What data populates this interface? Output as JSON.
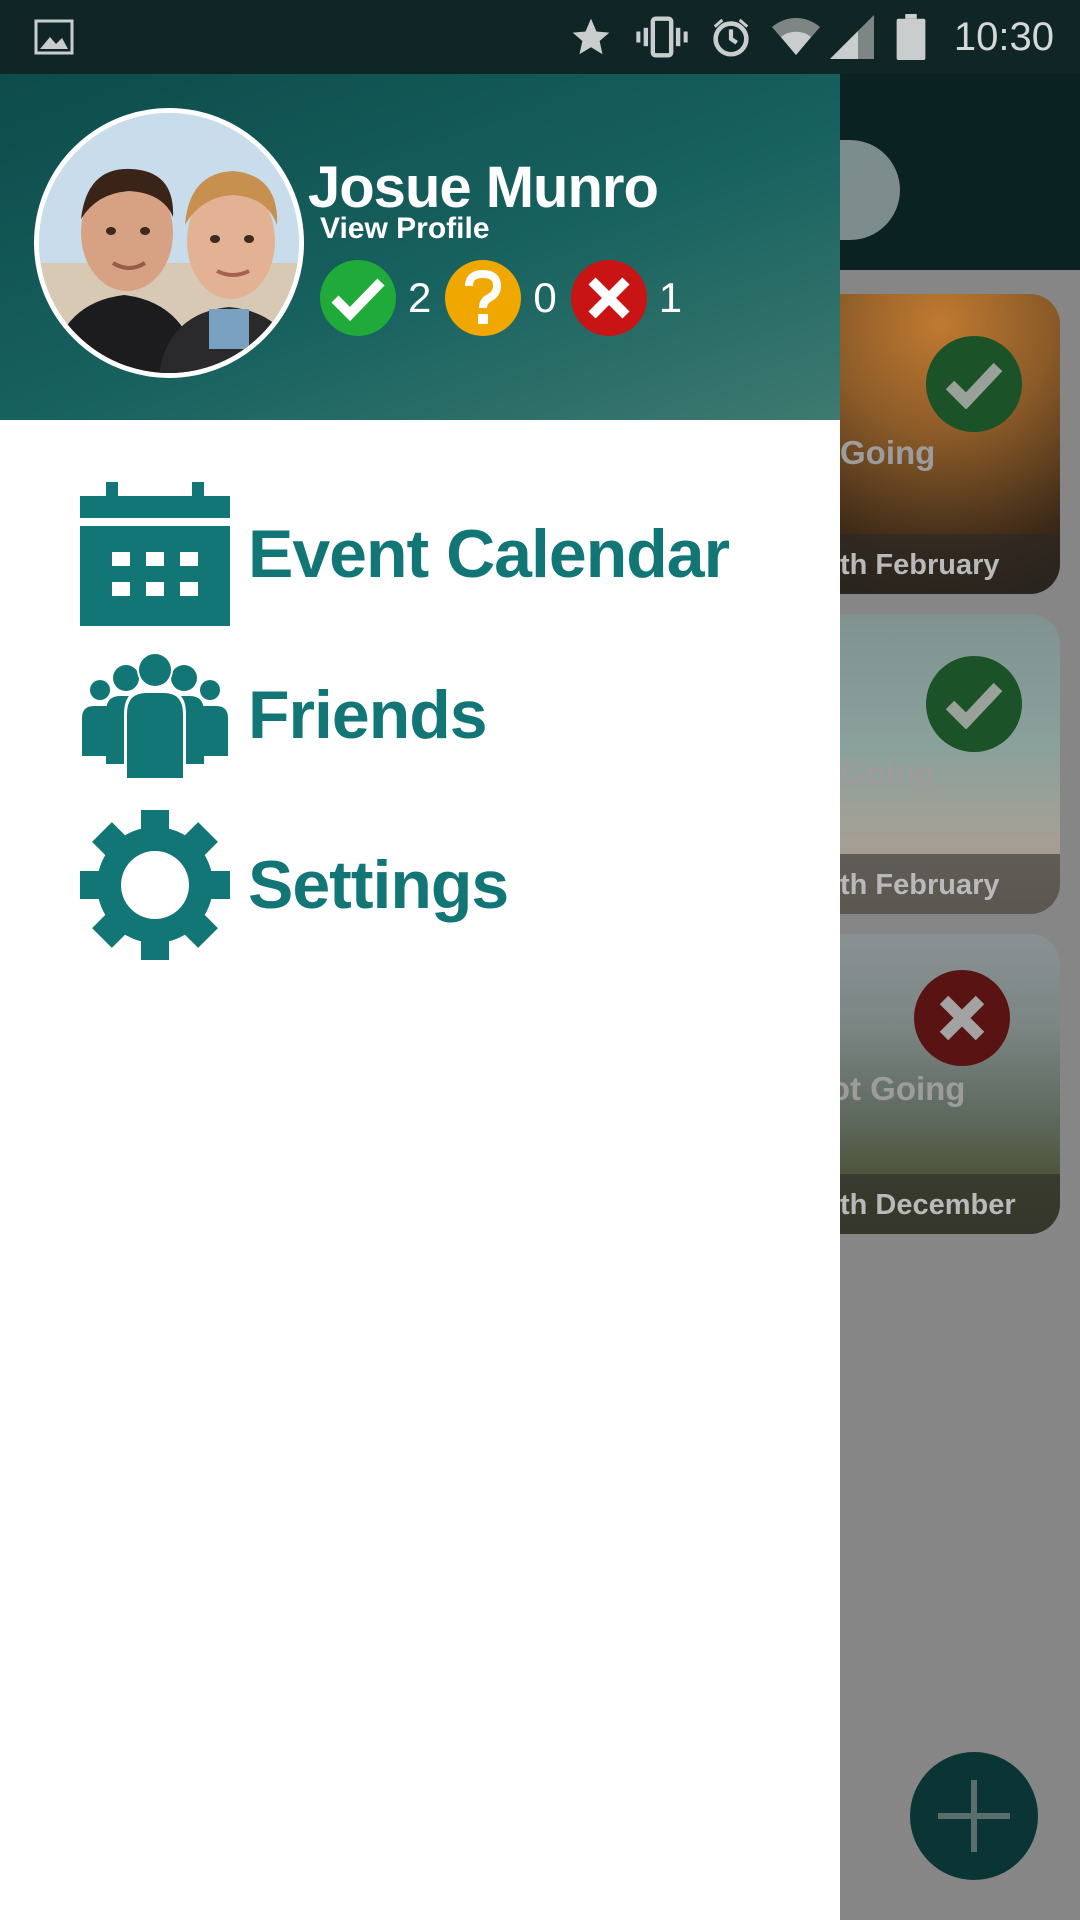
{
  "status_bar": {
    "icons": [
      "image-icon",
      "star-icon",
      "vibrate-icon",
      "alarm-icon",
      "wifi-icon",
      "signal-icon",
      "battery-icon"
    ],
    "time": "10:30"
  },
  "drawer": {
    "user": {
      "name": "Josue Munro",
      "view_profile": "View Profile"
    },
    "stats": {
      "going": "2",
      "maybe": "0",
      "not_going": "1"
    },
    "menu": [
      {
        "label": "Event Calendar",
        "icon": "calendar-icon"
      },
      {
        "label": "Friends",
        "icon": "people-icon"
      },
      {
        "label": "Settings",
        "icon": "gear-icon"
      }
    ]
  },
  "events": [
    {
      "status": "Going",
      "date": "th February"
    },
    {
      "status": "Going",
      "date": "th February"
    },
    {
      "status": "Not Going",
      "date": "th December"
    }
  ],
  "colors": {
    "accent": "#127676",
    "header_dark": "#0d4c4b",
    "going_green": "#1faa3a",
    "maybe_yellow": "#f0a800",
    "not_going_red": "#c81414"
  }
}
